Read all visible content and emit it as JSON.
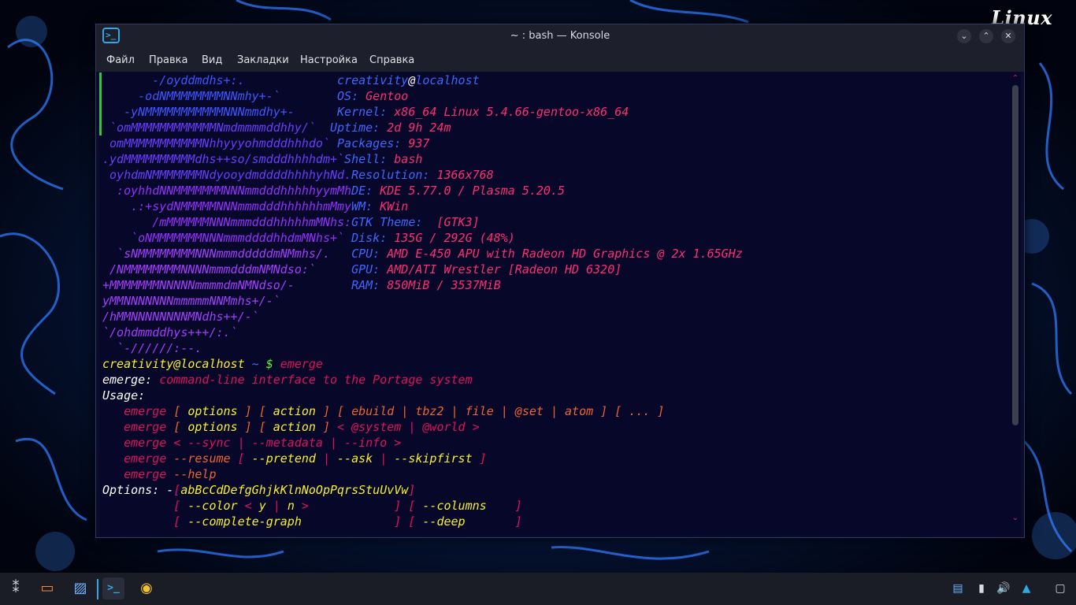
{
  "desktop": {
    "logo_text": "Linux"
  },
  "window": {
    "title": "~ : bash — Konsole",
    "menu": [
      "Файл",
      "Правка",
      "Вид",
      "Закладки",
      "Настройка",
      "Справка"
    ],
    "buttons": {
      "minimize": "⌄",
      "maximize": "⌃",
      "close": "✕"
    }
  },
  "terminal": {
    "lines": [
      [
        [
          "       -/oyddmdhs+:.             ",
          "c-mb"
        ],
        [
          "creativity",
          "c-bl"
        ],
        [
          "@",
          "c-wh"
        ],
        [
          "localhost",
          "c-bl"
        ]
      ],
      [
        [
          "     -odNMMMMMMMMNNmhy+-`        ",
          "c-mb"
        ],
        [
          "OS: ",
          "c-bl"
        ],
        [
          "Gentoo",
          "c-pink"
        ]
      ],
      [
        [
          "   -yNMMMMMMMMMMMNNNmmdhy+-      ",
          "c-mb"
        ],
        [
          "Kernel: ",
          "c-bl"
        ],
        [
          "x86_64 Linux 5.4.66-gentoo-x86_64",
          "c-pink"
        ]
      ],
      [
        [
          " `omMMMMMMMMMMMMNmdmmmmddhhy/`  ",
          "c-vi"
        ],
        [
          "Uptime: ",
          "c-bl"
        ],
        [
          "2d 9h 24m",
          "c-pink"
        ]
      ],
      [
        [
          " omMMMMMMMMMMMNhhyyyohmdddhhhdo` ",
          "c-vi"
        ],
        [
          "Packages: ",
          "c-bl"
        ],
        [
          "937",
          "c-pink"
        ]
      ],
      [
        [
          ".ydMMMMMMMMMMdhs++so/smdddhhhhdm+`",
          "c-vi"
        ],
        [
          "Shell: ",
          "c-bl"
        ],
        [
          "bash",
          "c-pink"
        ]
      ],
      [
        [
          " oyhdmNMMMMMMMNdyooydmddddhhhhyhNd.",
          "c-vi"
        ],
        [
          "Resolution: ",
          "c-bl"
        ],
        [
          "1366x768",
          "c-pink"
        ]
      ],
      [
        [
          "  :oyhhdNNMMMMMMMNNNmmdddhhhhhyymMh",
          "c-pu"
        ],
        [
          "DE: ",
          "c-bl"
        ],
        [
          "KDE 5.77.0 / Plasma 5.20.5",
          "c-pink"
        ]
      ],
      [
        [
          "    .:+sydNMMMMMNNNmmmdddhhhhhhmMmy",
          "c-pu"
        ],
        [
          "WM: ",
          "c-bl"
        ],
        [
          "KWin",
          "c-pink"
        ]
      ],
      [
        [
          "       /mMMMMMMNNNmmmdddhhhhhmMNhs:",
          "c-pu"
        ],
        [
          "GTK Theme: ",
          "c-bl"
        ],
        [
          " [GTK3]",
          "c-pink"
        ]
      ],
      [
        [
          "    `oNMMMMMMMNNNmmmddddhhdmMNhs+` ",
          "c-pu"
        ],
        [
          "Disk: ",
          "c-bl"
        ],
        [
          "135G / 292G (48%)",
          "c-pink"
        ]
      ],
      [
        [
          "  `sNMMMMMMMMNNNmmmdddddmNMmhs/.   ",
          "c-mg"
        ],
        [
          "CPU: ",
          "c-bl"
        ],
        [
          "AMD E-450 APU with Radeon HD Graphics @ 2x 1.65GHz",
          "c-pink"
        ]
      ],
      [
        [
          " /NMMMMMMMMNNNNmmmdddmNMNdso:`     ",
          "c-mg"
        ],
        [
          "GPU: ",
          "c-bl"
        ],
        [
          "AMD/ATI Wrestler [Radeon HD 6320]",
          "c-pink"
        ]
      ],
      [
        [
          "+MMMMMMMNNNNNmmmmdmNMNdso/-        ",
          "c-mg"
        ],
        [
          "RAM: ",
          "c-bl"
        ],
        [
          "850MiB / 3537MiB",
          "c-pink"
        ]
      ],
      [
        [
          "yMMNNNNNNNmmmmmNNMmhs+/-`",
          "c-mg"
        ]
      ],
      [
        [
          "/hMMNNNNNNNNMNdhs++/-`",
          "c-mg"
        ]
      ],
      [
        [
          "`/ohdmmddhys+++/:.`",
          "c-mg"
        ]
      ],
      [
        [
          "  `-//////:--.",
          "c-mg"
        ]
      ],
      [
        [
          "creativity@localhost",
          "c-ye"
        ],
        [
          " ~ ",
          "c-bl"
        ],
        [
          "$",
          "c-gr"
        ],
        [
          " emerge",
          "c-rd"
        ]
      ],
      [
        [
          "emerge:",
          "c-wh"
        ],
        [
          " command-line interface to the Portage system",
          "c-rd"
        ]
      ],
      [
        [
          "Usage:",
          "c-wh"
        ]
      ],
      [
        [
          "   emerge ",
          "c-rd"
        ],
        [
          "[",
          "c-or"
        ],
        [
          " options ",
          "c-ye"
        ],
        [
          "]",
          "c-or"
        ],
        [
          " ",
          "c-rd"
        ],
        [
          "[",
          "c-or"
        ],
        [
          " action ",
          "c-ye"
        ],
        [
          "]",
          "c-or"
        ],
        [
          " [ ebuild | tbz2 | file | @set | atom ] [ ... ]",
          "c-or"
        ]
      ],
      [
        [
          "   emerge ",
          "c-rd"
        ],
        [
          "[",
          "c-or"
        ],
        [
          " options ",
          "c-ye"
        ],
        [
          "]",
          "c-or"
        ],
        [
          " ",
          "c-rd"
        ],
        [
          "[",
          "c-or"
        ],
        [
          " action ",
          "c-ye"
        ],
        [
          "]",
          "c-or"
        ],
        [
          " < @system | @world >",
          "c-rd"
        ]
      ],
      [
        [
          "   emerge ",
          "c-rd"
        ],
        [
          "< --sync | --metadata | --info >",
          "c-rd"
        ]
      ],
      [
        [
          "   emerge ",
          "c-rd"
        ],
        [
          "--resume ",
          "c-or"
        ],
        [
          "[",
          "c-rd"
        ],
        [
          " --pretend ",
          "c-ye"
        ],
        [
          "|",
          "c-rd"
        ],
        [
          " --ask ",
          "c-ye"
        ],
        [
          "|",
          "c-rd"
        ],
        [
          " --skipfirst ",
          "c-ye"
        ],
        [
          "]",
          "c-rd"
        ]
      ],
      [
        [
          "   emerge ",
          "c-rd"
        ],
        [
          "--help",
          "c-or"
        ]
      ],
      [
        [
          "Options:",
          "c-wh"
        ],
        [
          " -",
          "c-wh"
        ],
        [
          "[",
          "c-rd"
        ],
        [
          "abBcCdDefgGhjkKlnNoOpPqrsStuUvVw",
          "c-ye"
        ],
        [
          "]",
          "c-rd"
        ]
      ],
      [
        [
          "          [ ",
          "c-rd"
        ],
        [
          "--color",
          "c-ye"
        ],
        [
          " < ",
          "c-rd"
        ],
        [
          "y",
          "c-ye"
        ],
        [
          " | ",
          "c-rd"
        ],
        [
          "n",
          "c-ye"
        ],
        [
          " >",
          "c-rd"
        ],
        [
          "            ] [ ",
          "c-rd"
        ],
        [
          "--columns",
          "c-ye"
        ],
        [
          "    ]",
          "c-rd"
        ]
      ],
      [
        [
          "          [ ",
          "c-rd"
        ],
        [
          "--complete-graph",
          "c-ye"
        ],
        [
          "             ] [ ",
          "c-rd"
        ],
        [
          "--deep",
          "c-ye"
        ],
        [
          "       ]",
          "c-rd"
        ]
      ]
    ]
  },
  "taskbar": {
    "items": [
      {
        "name": "app-launcher-icon",
        "glyph": "⁑"
      },
      {
        "name": "file-manager-icon",
        "glyph": "▭"
      },
      {
        "name": "system-monitor-icon",
        "glyph": "▨"
      },
      {
        "name": "konsole-icon",
        "glyph": ">_"
      },
      {
        "name": "chrome-icon",
        "glyph": "◉"
      }
    ],
    "tray": [
      {
        "name": "clipboard-icon",
        "glyph": "▤"
      },
      {
        "name": "usb-device-icon",
        "glyph": "▮"
      },
      {
        "name": "volume-icon",
        "glyph": "🔊"
      },
      {
        "name": "tray-expand-icon",
        "glyph": "▲"
      },
      {
        "name": "show-desktop-icon",
        "glyph": "▢"
      }
    ]
  }
}
